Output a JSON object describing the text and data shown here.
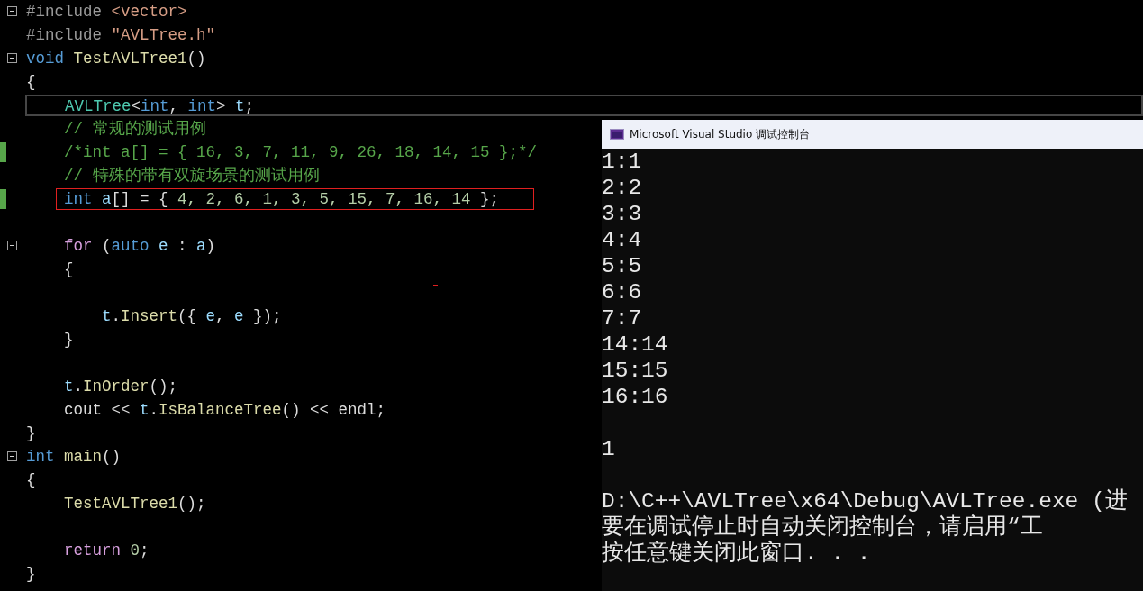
{
  "editor": {
    "lines": [
      {
        "fold": true,
        "modified": false,
        "current": false,
        "boxed": false,
        "kind": "top",
        "segments": [
          {
            "kind": "pre",
            "text": "#include "
          },
          {
            "kind": "str",
            "text": "<vector>"
          }
        ]
      },
      {
        "fold": false,
        "modified": false,
        "current": false,
        "boxed": false,
        "kind": "top",
        "segments": [
          {
            "kind": "pre",
            "text": "#include "
          },
          {
            "kind": "str",
            "text": "\"AVLTree.h\""
          }
        ]
      },
      {
        "fold": true,
        "modified": false,
        "current": false,
        "boxed": false,
        "kind": "top",
        "segments": [
          {
            "kind": "kw",
            "text": "void "
          },
          {
            "kind": "fn",
            "text": "TestAVLTree1"
          },
          {
            "kind": "id",
            "text": "()"
          }
        ]
      },
      {
        "fold": false,
        "modified": false,
        "current": false,
        "boxed": false,
        "kind": "top",
        "segments": [
          {
            "kind": "id",
            "text": "{"
          }
        ]
      },
      {
        "fold": false,
        "modified": false,
        "current": true,
        "boxed": false,
        "kind": "block",
        "segments": [
          {
            "kind": "type",
            "text": "AVLTree"
          },
          {
            "kind": "id",
            "text": "<"
          },
          {
            "kind": "kw",
            "text": "int"
          },
          {
            "kind": "id",
            "text": ", "
          },
          {
            "kind": "kw",
            "text": "int"
          },
          {
            "kind": "id",
            "text": "> "
          },
          {
            "kind": "var",
            "text": "t"
          },
          {
            "kind": "id",
            "text": ";"
          }
        ]
      },
      {
        "fold": false,
        "modified": false,
        "current": false,
        "boxed": false,
        "kind": "block",
        "segments": [
          {
            "kind": "cm",
            "text": "// 常规的测试用例"
          }
        ]
      },
      {
        "fold": false,
        "modified": true,
        "current": false,
        "boxed": false,
        "kind": "block",
        "segments": [
          {
            "kind": "cm",
            "text": "/*int a[] = { 16, 3, 7, 11, 9, 26, 18, 14, 15 };*/"
          }
        ]
      },
      {
        "fold": false,
        "modified": false,
        "current": false,
        "boxed": false,
        "kind": "block",
        "segments": [
          {
            "kind": "cm",
            "text": "// 特殊的带有双旋场景的测试用例"
          }
        ]
      },
      {
        "fold": false,
        "modified": true,
        "current": false,
        "boxed": true,
        "kind": "block",
        "segments": [
          {
            "kind": "kw",
            "text": "int "
          },
          {
            "kind": "var",
            "text": "a"
          },
          {
            "kind": "id",
            "text": "[] = { "
          },
          {
            "kind": "num",
            "text": "4, 2, 6, 1, 3, 5, 15, 7, 16, 14"
          },
          {
            "kind": "id",
            "text": " };"
          }
        ]
      },
      {
        "fold": false,
        "modified": false
      },
      {
        "fold": true,
        "modified": false,
        "current": false,
        "boxed": false,
        "kind": "block",
        "segments": [
          {
            "kind": "ctl",
            "text": "for "
          },
          {
            "kind": "id",
            "text": "("
          },
          {
            "kind": "kw",
            "text": "auto "
          },
          {
            "kind": "var",
            "text": "e"
          },
          {
            "kind": "id",
            "text": " : "
          },
          {
            "kind": "var",
            "text": "a"
          },
          {
            "kind": "id",
            "text": ")"
          }
        ]
      },
      {
        "fold": false,
        "modified": false,
        "current": false,
        "boxed": false,
        "kind": "block",
        "segments": [
          {
            "kind": "id",
            "text": "{"
          }
        ]
      },
      {
        "fold": false,
        "modified": false
      },
      {
        "fold": false,
        "modified": false,
        "current": false,
        "boxed": false,
        "kind": "inner",
        "segments": [
          {
            "kind": "var",
            "text": "t"
          },
          {
            "kind": "id",
            "text": "."
          },
          {
            "kind": "fn",
            "text": "Insert"
          },
          {
            "kind": "id",
            "text": "({ "
          },
          {
            "kind": "var",
            "text": "e"
          },
          {
            "kind": "id",
            "text": ", "
          },
          {
            "kind": "var",
            "text": "e"
          },
          {
            "kind": "id",
            "text": " });"
          }
        ]
      },
      {
        "fold": false,
        "modified": false,
        "current": false,
        "boxed": false,
        "kind": "block",
        "segments": [
          {
            "kind": "id",
            "text": "}"
          }
        ]
      },
      {
        "fold": false,
        "modified": false
      },
      {
        "fold": false,
        "modified": false,
        "current": false,
        "boxed": false,
        "kind": "block",
        "segments": [
          {
            "kind": "var",
            "text": "t"
          },
          {
            "kind": "id",
            "text": "."
          },
          {
            "kind": "fn",
            "text": "InOrder"
          },
          {
            "kind": "id",
            "text": "();"
          }
        ]
      },
      {
        "fold": false,
        "modified": false,
        "current": false,
        "boxed": false,
        "kind": "block",
        "segments": [
          {
            "kind": "id",
            "text": "cout << "
          },
          {
            "kind": "var",
            "text": "t"
          },
          {
            "kind": "id",
            "text": "."
          },
          {
            "kind": "fn",
            "text": "IsBalanceTree"
          },
          {
            "kind": "id",
            "text": "() << endl;"
          }
        ]
      },
      {
        "fold": false,
        "modified": false,
        "current": false,
        "boxed": false,
        "kind": "top",
        "segments": [
          {
            "kind": "id",
            "text": "}"
          }
        ]
      },
      {
        "fold": true,
        "modified": false,
        "current": false,
        "boxed": false,
        "kind": "top",
        "segments": [
          {
            "kind": "kw",
            "text": "int "
          },
          {
            "kind": "fn",
            "text": "main"
          },
          {
            "kind": "id",
            "text": "()"
          }
        ]
      },
      {
        "fold": false,
        "modified": false,
        "current": false,
        "boxed": false,
        "kind": "top",
        "segments": [
          {
            "kind": "id",
            "text": "{"
          }
        ]
      },
      {
        "fold": false,
        "modified": false,
        "current": false,
        "boxed": false,
        "kind": "block",
        "segments": [
          {
            "kind": "fn",
            "text": "TestAVLTree1"
          },
          {
            "kind": "id",
            "text": "();"
          }
        ]
      },
      {
        "fold": false,
        "modified": false
      },
      {
        "fold": false,
        "modified": false,
        "current": false,
        "boxed": false,
        "kind": "block",
        "segments": [
          {
            "kind": "ctl",
            "text": "return "
          },
          {
            "kind": "num",
            "text": "0"
          },
          {
            "kind": "id",
            "text": ";"
          }
        ]
      },
      {
        "fold": false,
        "modified": false,
        "current": false,
        "boxed": false,
        "kind": "top",
        "segments": [
          {
            "kind": "id",
            "text": "}"
          }
        ]
      }
    ]
  },
  "console": {
    "title": "Microsoft Visual Studio 调试控制台",
    "output": [
      "1:1",
      "2:2",
      "3:3",
      "4:4",
      "5:5",
      "6:6",
      "7:7",
      "14:14",
      "15:15",
      "16:16"
    ],
    "result": "1",
    "message": [
      "D:\\C++\\AVLTree\\x64\\Debug\\AVLTree.exe (进",
      "要在调试停止时自动关闭控制台，请启用“工",
      "按任意键关闭此窗口. . ."
    ]
  }
}
